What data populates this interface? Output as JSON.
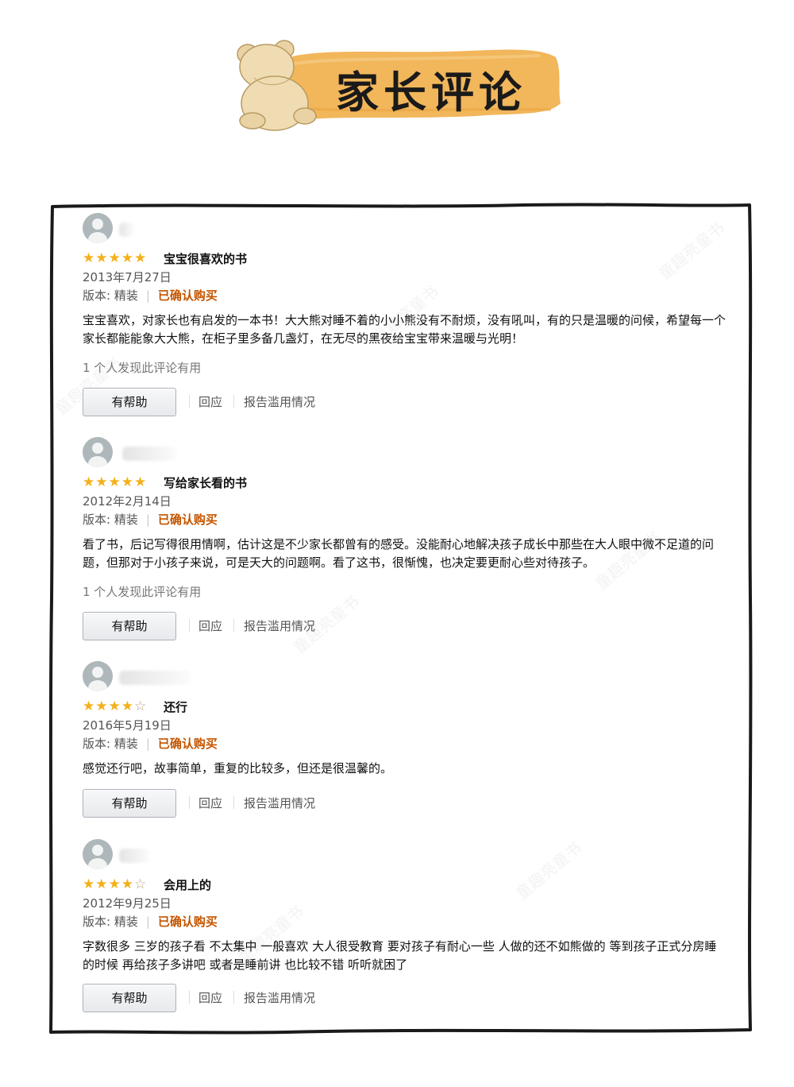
{
  "header": {
    "title": "家长评论"
  },
  "watermark": "童趣亮童书",
  "reviews": [
    {
      "rating": 5,
      "title": "宝宝很喜欢的书",
      "date": "2013年7月27日",
      "format": "版本: 精装",
      "verified": "已确认购买",
      "body": "宝宝喜欢，对家长也有启发的一本书！大大熊对睡不着的小小熊没有不耐烦，没有吼叫，有的只是温暖的问候，希望每一个家长都能能象大大熊，在柜子里多备几盏灯，在无尽的黑夜给宝宝带来温暖与光明！",
      "helpful_count": "1 个人发现此评论有用",
      "helpful_button": "有帮助",
      "reply": "回应",
      "report": "报告滥用情况"
    },
    {
      "rating": 5,
      "title": "写给家长看的书",
      "date": "2012年2月14日",
      "format": "版本: 精装",
      "verified": "已确认购买",
      "body": "看了书，后记写得很用情啊，估计这是不少家长都曾有的感受。没能耐心地解决孩子成长中那些在大人眼中微不足道的问题，但那对于小孩子来说，可是天大的问题啊。看了这书，很惭愧，也决定要更耐心些对待孩子。",
      "helpful_count": "1 个人发现此评论有用",
      "helpful_button": "有帮助",
      "reply": "回应",
      "report": "报告滥用情况"
    },
    {
      "rating": 4,
      "title": "还行",
      "date": "2016年5月19日",
      "format": "版本: 精装",
      "verified": "已确认购买",
      "body": "感觉还行吧，故事简单，重复的比较多，但还是很温馨的。",
      "helpful_count": "",
      "helpful_button": "有帮助",
      "reply": "回应",
      "report": "报告滥用情况"
    },
    {
      "rating": 4,
      "title": "会用上的",
      "date": "2012年9月25日",
      "format": "版本: 精装",
      "verified": "已确认购买",
      "body": "字数很多 三岁的孩子看 不太集中 一般喜欢 大人很受教育 要对孩子有耐心一些 人做的还不如熊做的 等到孩子正式分房睡的时候 再给孩子多讲吧 或者是睡前讲 也比较不错 听听就困了",
      "helpful_count": "",
      "helpful_button": "有帮助",
      "reply": "回应",
      "report": "报告滥用情况"
    }
  ],
  "colors": {
    "banner": "#f2b65b",
    "star": "#f4b018",
    "verified": "#c45500",
    "frame": "#1a1a1a"
  }
}
